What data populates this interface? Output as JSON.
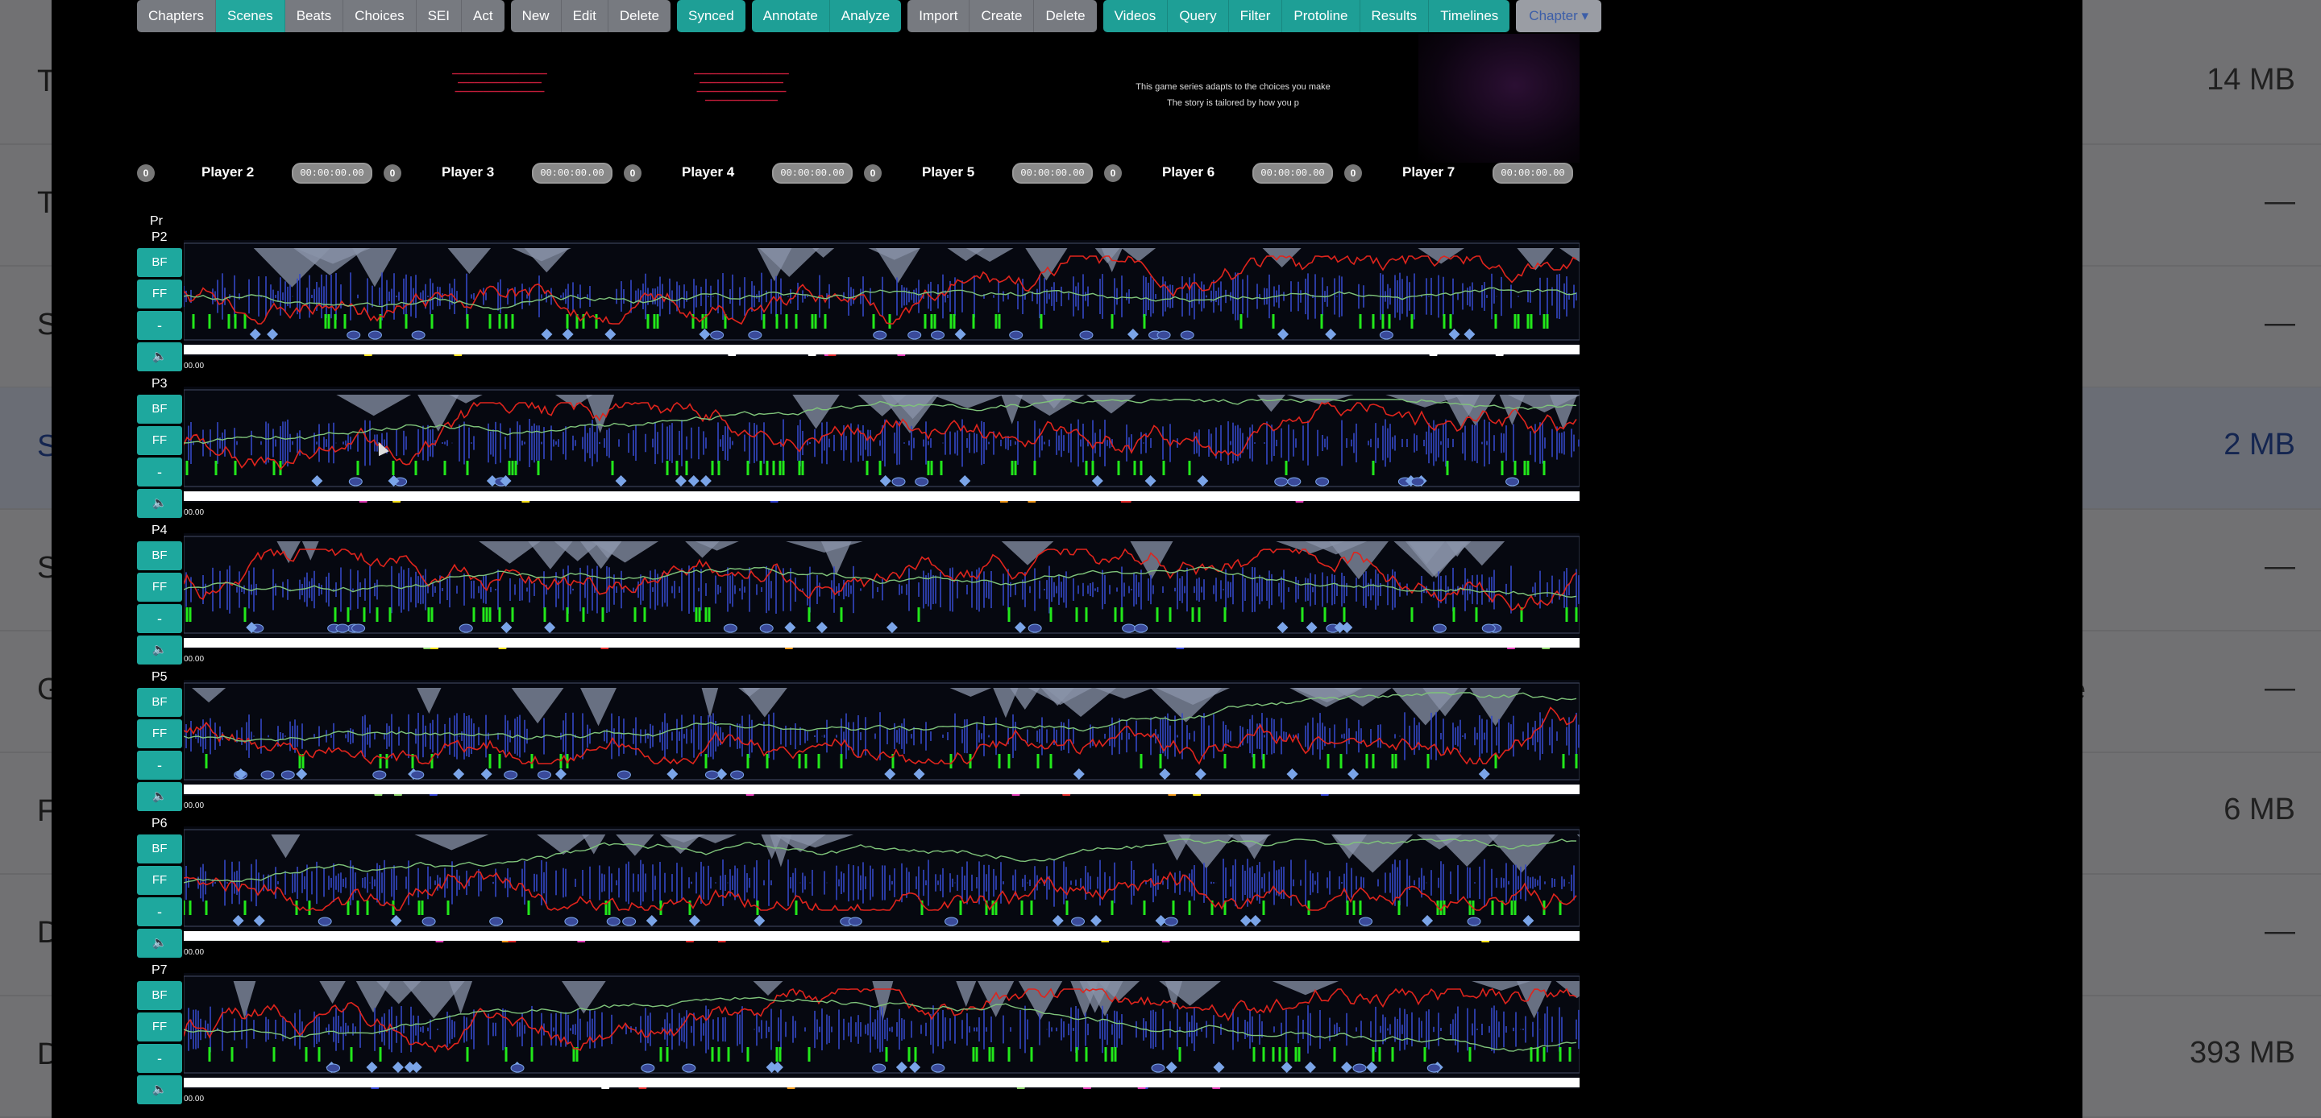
{
  "background_list": {
    "rows": [
      {
        "letter": "T",
        "size": "14 MB",
        "extra": "",
        "selected": false
      },
      {
        "letter": "T",
        "size": "—",
        "extra": "",
        "selected": false
      },
      {
        "letter": "S",
        "size": "—",
        "extra": "",
        "selected": false
      },
      {
        "letter": "S",
        "size": "2 MB",
        "extra": "",
        "selected": true
      },
      {
        "letter": "S",
        "size": "—",
        "extra": "",
        "selected": false
      },
      {
        "letter": "G",
        "size": "—",
        "extra": "ne",
        "selected": false
      },
      {
        "letter": "F",
        "size": "6 MB",
        "extra": "",
        "selected": false
      },
      {
        "letter": "D",
        "size": "—",
        "extra": "",
        "selected": false
      },
      {
        "letter": "D",
        "size": "393 MB",
        "extra": "",
        "selected": false
      }
    ]
  },
  "toolbar": {
    "groups": [
      {
        "style": "gray",
        "buttons": [
          {
            "label": "Chapters",
            "name": "chapters",
            "active": false
          },
          {
            "label": "Scenes",
            "name": "scenes",
            "active": true
          },
          {
            "label": "Beats",
            "name": "beats",
            "active": false
          },
          {
            "label": "Choices",
            "name": "choices",
            "active": false
          },
          {
            "label": "SEI",
            "name": "sei",
            "active": false
          },
          {
            "label": "Act",
            "name": "act",
            "active": false
          }
        ]
      },
      {
        "style": "gray",
        "buttons": [
          {
            "label": "New",
            "name": "new",
            "active": false
          },
          {
            "label": "Edit",
            "name": "edit",
            "active": false
          },
          {
            "label": "Delete",
            "name": "delete",
            "active": false
          }
        ]
      },
      {
        "style": "teal",
        "buttons": [
          {
            "label": "Synced",
            "name": "synced",
            "active": false
          }
        ]
      },
      {
        "style": "teal",
        "buttons": [
          {
            "label": "Annotate",
            "name": "annotate",
            "active": false
          },
          {
            "label": "Analyze",
            "name": "analyze",
            "active": false
          }
        ]
      },
      {
        "style": "gray",
        "buttons": [
          {
            "label": "Import",
            "name": "import",
            "active": false
          },
          {
            "label": "Create",
            "name": "create",
            "active": false
          },
          {
            "label": "Delete",
            "name": "delete-2",
            "active": false
          }
        ]
      },
      {
        "style": "teal",
        "buttons": [
          {
            "label": "Videos",
            "name": "videos",
            "active": false
          },
          {
            "label": "Query",
            "name": "query",
            "active": false
          },
          {
            "label": "Filter",
            "name": "filter",
            "active": false
          },
          {
            "label": "Protoline",
            "name": "protoline",
            "active": false
          },
          {
            "label": "Results",
            "name": "results",
            "active": false
          },
          {
            "label": "Timelines",
            "name": "timelines",
            "active": false
          }
        ]
      },
      {
        "style": "gray",
        "buttons": [
          {
            "label": "Chapter ▾",
            "name": "chapter-dropdown",
            "active": false,
            "chapter": true
          }
        ]
      }
    ]
  },
  "preview": {
    "story_lines": [
      "This game series adapts to the choices you make",
      "The story is tailored by how you p"
    ]
  },
  "players": {
    "first_count": "0",
    "items": [
      {
        "name": "Player 2",
        "time": "00:00:00.00",
        "count": "0"
      },
      {
        "name": "Player 3",
        "time": "00:00:00.00",
        "count": "0"
      },
      {
        "name": "Player 4",
        "time": "00:00:00.00",
        "count": "0"
      },
      {
        "name": "Player 5",
        "time": "00:00:00.00",
        "count": "0"
      },
      {
        "name": "Player 6",
        "time": "00:00:00.00",
        "count": "0"
      },
      {
        "name": "Player 7",
        "time": "00:00:00.00",
        "count": ""
      }
    ]
  },
  "pr_label": "Pr",
  "rows": [
    {
      "label": "P2",
      "bf": "BF",
      "ff": "FF",
      "dash": "-",
      "mute": "🔈",
      "timecode": "00.00"
    },
    {
      "label": "P3",
      "bf": "BF",
      "ff": "FF",
      "dash": "-",
      "mute": "🔈",
      "timecode": "00.00"
    },
    {
      "label": "P4",
      "bf": "BF",
      "ff": "FF",
      "dash": "-",
      "mute": "🔈",
      "timecode": "00.00"
    },
    {
      "label": "P5",
      "bf": "BF",
      "ff": "FF",
      "dash": "-",
      "mute": "🔈",
      "timecode": "00.00"
    },
    {
      "label": "P6",
      "bf": "BF",
      "ff": "FF",
      "dash": "-",
      "mute": "🔈",
      "timecode": "00.00"
    },
    {
      "label": "P7",
      "bf": "BF",
      "ff": "FF",
      "dash": "-",
      "mute": "🔈",
      "timecode": "00.00"
    }
  ],
  "colors": {
    "teal": "#1ea89e",
    "red_line": "#e0241c",
    "green_line": "#7fc47a",
    "blue_fill": "#3447c4",
    "gray_fill": "#8a93a8",
    "bright_green": "#22e81a",
    "marker": "#7aa4e8"
  }
}
